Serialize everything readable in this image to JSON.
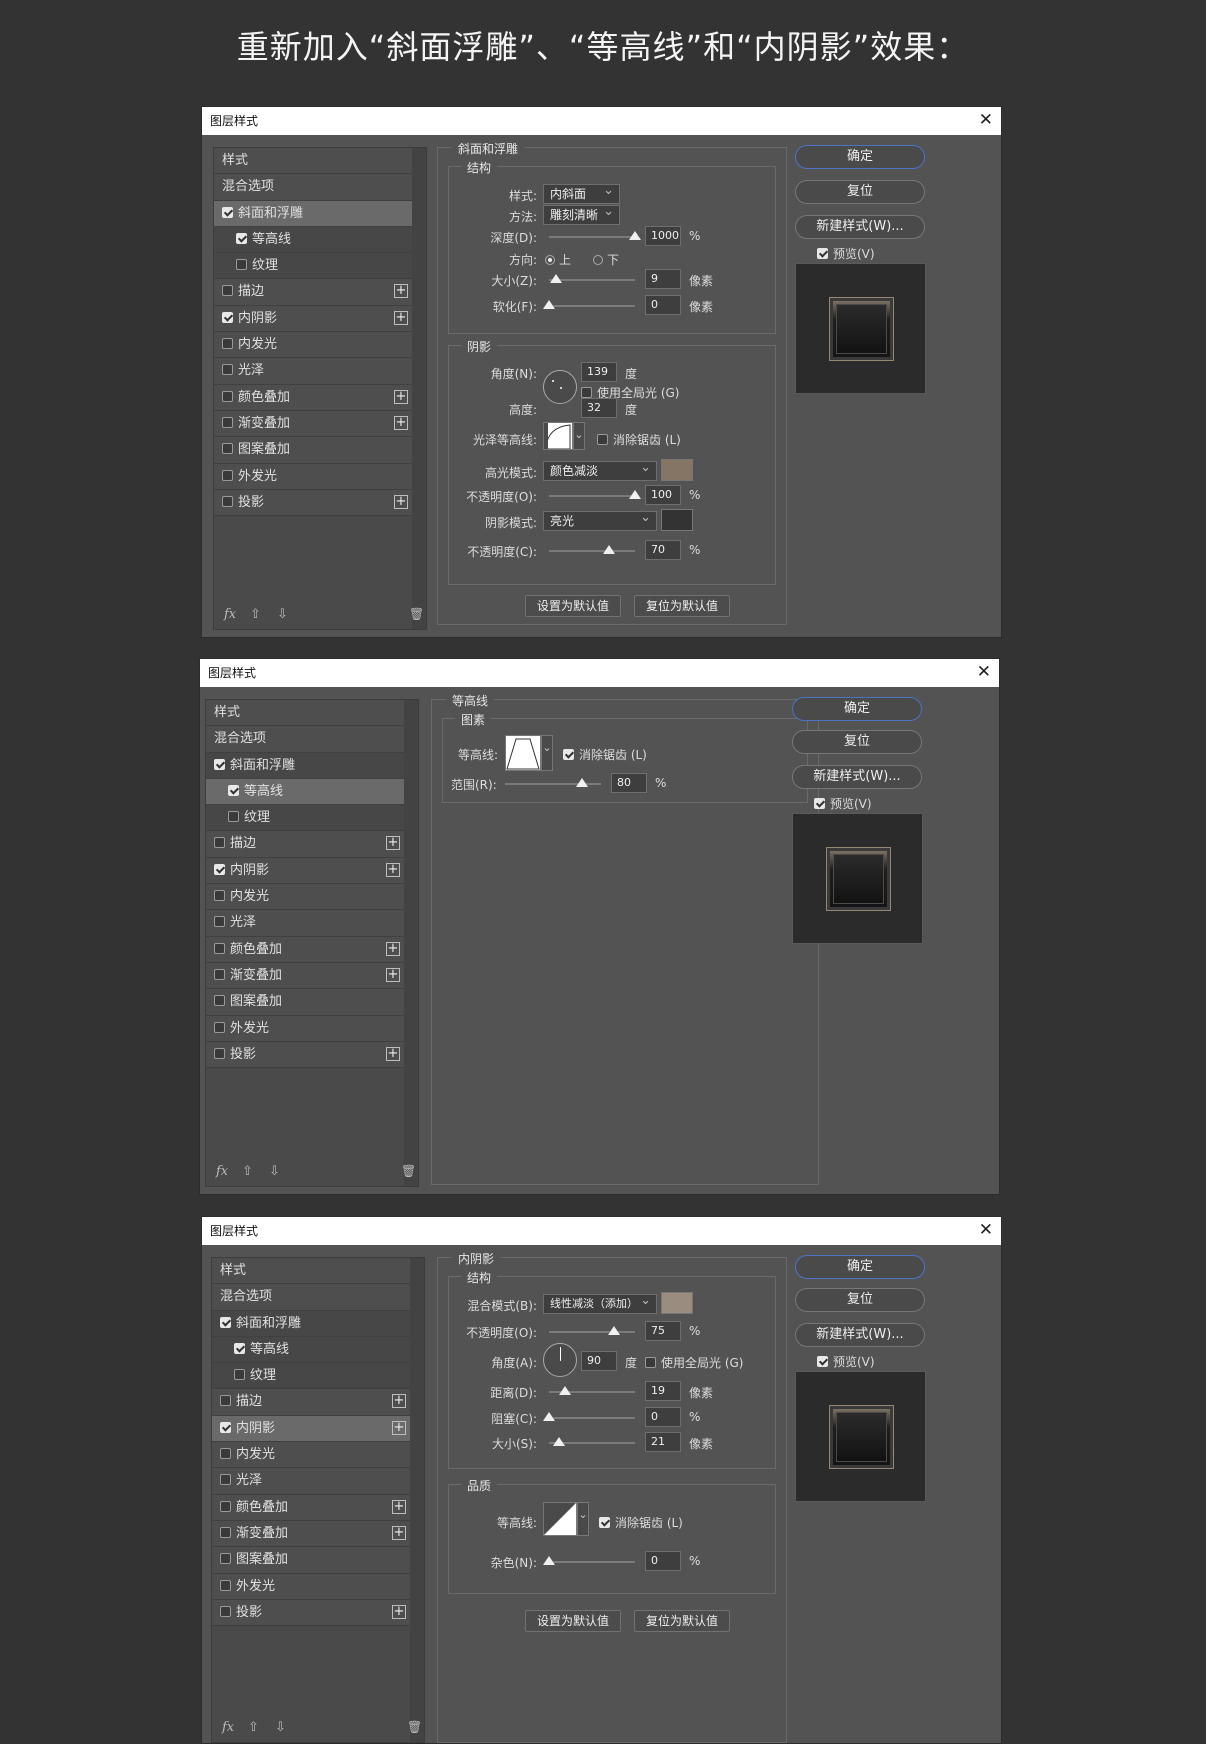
{
  "heading": "重新加入“斜面浮雕”、“等高线”和“内阴影”效果：",
  "dialog_title": "图层样式",
  "left_items": [
    {
      "label": "样式",
      "check": null,
      "plus": false,
      "indent": false
    },
    {
      "label": "混合选项",
      "check": null,
      "plus": false,
      "indent": false
    },
    {
      "label": "斜面和浮雕",
      "check": true,
      "plus": false,
      "indent": false
    },
    {
      "label": "等高线",
      "check": true,
      "plus": false,
      "indent": true
    },
    {
      "label": "纹理",
      "check": false,
      "plus": false,
      "indent": true
    },
    {
      "label": "描边",
      "check": false,
      "plus": true,
      "indent": false
    },
    {
      "label": "内阴影",
      "check": true,
      "plus": true,
      "indent": false
    },
    {
      "label": "内发光",
      "check": false,
      "plus": false,
      "indent": false
    },
    {
      "label": "光泽",
      "check": false,
      "plus": false,
      "indent": false
    },
    {
      "label": "颜色叠加",
      "check": false,
      "plus": true,
      "indent": false
    },
    {
      "label": "渐变叠加",
      "check": false,
      "plus": true,
      "indent": false
    },
    {
      "label": "图案叠加",
      "check": false,
      "plus": false,
      "indent": false
    },
    {
      "label": "外发光",
      "check": false,
      "plus": false,
      "indent": false
    },
    {
      "label": "投影",
      "check": false,
      "plus": true,
      "indent": false
    }
  ],
  "buttons": {
    "ok": "确定",
    "reset": "复位",
    "new_style": "新建样式(W)...",
    "preview": "预览(V)",
    "set_default": "设置为默认值",
    "reset_default": "复位为默认值"
  },
  "footer": {
    "fx": "fx",
    "up": "⇧",
    "down": "⇩",
    "trash": "🗑"
  },
  "d1": {
    "group": "斜面和浮雕",
    "structure": "结构",
    "style_label": "样式:",
    "style_value": "内斜面",
    "technique_label": "方法:",
    "technique_value": "雕刻清晰",
    "depth_label": "深度(D):",
    "depth_value": "1000",
    "depth_unit": "%",
    "direction_label": "方向:",
    "dir_up": "上",
    "dir_down": "下",
    "size_label": "大小(Z):",
    "size_value": "9",
    "size_unit": "像素",
    "soften_label": "软化(F):",
    "soften_value": "0",
    "soften_unit": "像素",
    "shading": "阴影",
    "angle_label": "角度(N):",
    "angle_value": "139",
    "angle_unit": "度",
    "global_light": "使用全局光 (G)",
    "altitude_label": "高度:",
    "altitude_value": "32",
    "altitude_unit": "度",
    "gloss_label": "光泽等高线:",
    "antialias": "消除锯齿 (L)",
    "hl_mode_label": "高光模式:",
    "hl_mode_value": "颜色减淡",
    "hl_color": "#857565",
    "hl_opacity_label": "不透明度(O):",
    "hl_opacity_value": "100",
    "pct": "%",
    "sh_mode_label": "阴影模式:",
    "sh_mode_value": "亮光",
    "sh_color": "#333333",
    "sh_opacity_label": "不透明度(C):",
    "sh_opacity_value": "70"
  },
  "d2": {
    "group": "等高线",
    "elements": "图素",
    "contour_label": "等高线:",
    "antialias": "消除锯齿 (L)",
    "range_label": "范围(R):",
    "range_value": "80",
    "pct": "%"
  },
  "d3": {
    "group": "内阴影",
    "structure": "结构",
    "blend_label": "混合模式(B):",
    "blend_value": "线性减淡（添加）",
    "blend_color": "#9a8d80",
    "opacity_label": "不透明度(O):",
    "opacity_value": "75",
    "pct": "%",
    "angle_label": "角度(A):",
    "angle_value": "90",
    "angle_unit": "度",
    "global_light": "使用全局光 (G)",
    "distance_label": "距离(D):",
    "distance_value": "19",
    "px": "像素",
    "choke_label": "阻塞(C):",
    "choke_value": "0",
    "size_label": "大小(S):",
    "size_value": "21",
    "quality": "品质",
    "contour_label": "等高线:",
    "antialias": "消除锯齿 (L)",
    "noise_label": "杂色(N):",
    "noise_value": "0"
  }
}
